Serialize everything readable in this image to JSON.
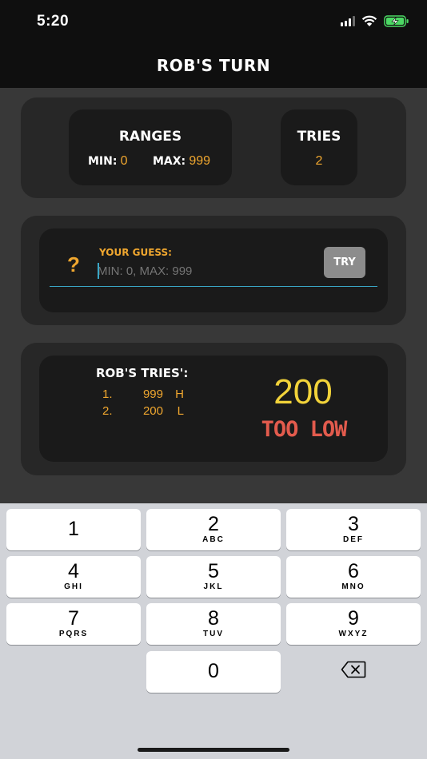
{
  "status_bar": {
    "time": "5:20"
  },
  "nav": {
    "title": "ROB'S TURN"
  },
  "ranges": {
    "title": "RANGES",
    "min_label": "MIN:",
    "min_value": "0",
    "max_label": "MAX:",
    "max_value": "999"
  },
  "tries": {
    "title": "TRIES",
    "value": "2"
  },
  "guess": {
    "icon": "?",
    "label": "YOUR GUESS:",
    "placeholder": "MIN: 0, MAX: 999",
    "button_label": "TRY"
  },
  "history": {
    "title": "ROB'S TRIES':",
    "items": [
      {
        "number": "1.",
        "value": "999",
        "hint": "H"
      },
      {
        "number": "2.",
        "value": "200",
        "hint": "L"
      }
    ],
    "last_guess": "200",
    "feedback": "TOO LOW"
  },
  "keyboard": {
    "keys": [
      {
        "digit": "1",
        "letters": ""
      },
      {
        "digit": "2",
        "letters": "ABC"
      },
      {
        "digit": "3",
        "letters": "DEF"
      },
      {
        "digit": "4",
        "letters": "GHI"
      },
      {
        "digit": "5",
        "letters": "JKL"
      },
      {
        "digit": "6",
        "letters": "MNO"
      },
      {
        "digit": "7",
        "letters": "PQRS"
      },
      {
        "digit": "8",
        "letters": "TUV"
      },
      {
        "digit": "9",
        "letters": "WXYZ"
      },
      {
        "digit": "0",
        "letters": ""
      }
    ],
    "backspace_icon": "backspace-icon"
  },
  "colors": {
    "accent": "#f0a72f",
    "last_guess": "#f2d33a",
    "feedback": "#e35b4d",
    "input_line": "#3aa7c7"
  }
}
